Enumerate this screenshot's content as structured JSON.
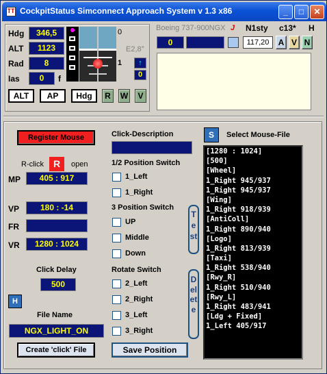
{
  "title": "CockpitStatus Simconnect Approach System v 1.3   x86",
  "app_icon": "TT",
  "window_buttons": {
    "minimize": "_",
    "maximize": "□",
    "close": "✕"
  },
  "instruments": {
    "hdg_label": "Hdg",
    "hdg_value": "346,5",
    "alt_label": "ALT",
    "alt_value": "1123",
    "rad_label": "Rad",
    "rad_value": "8",
    "ias_label": "Ias",
    "ias_value": "0",
    "ias_flag": "f",
    "gauge_top_num": "0",
    "gauge_e_text": "E2,8°",
    "gauge_side_num": "1",
    "gauge_small_value": "0",
    "btn_alt": "ALT",
    "btn_ap": "AP",
    "btn_hdg": "Hdg",
    "btn_r": "R",
    "btn_w": "W",
    "btn_v": "V"
  },
  "aircraft": {
    "name": "Boeing 737-900NGX",
    "j": "J",
    "n1sty": "N1sty",
    "c13": "c13*",
    "h": "H",
    "value_box": "0",
    "n1_value": "117,20",
    "btn_a": "A",
    "btn_v": "V",
    "btn_n": "N"
  },
  "left_panel": {
    "register_mouse": "Register Mouse",
    "rclick_label": "R-click",
    "rclick_letter": "R",
    "open_label": "open",
    "mp_label": "MP",
    "mp_value": "405 : 917",
    "vp_label": "VP",
    "vp_value": "180 : -14",
    "fr_label": "FR",
    "fr_value": "",
    "vr_label": "VR",
    "vr_value": "1280 : 1024",
    "click_delay_label": "Click Delay",
    "click_delay_value": "500",
    "h_button": "H",
    "file_name_label": "File Name",
    "file_name_value": "NGX_LIGHT_ON",
    "create_button": "Create 'click' File"
  },
  "mid_panel": {
    "click_desc_label": "Click-Description",
    "click_desc_value": "",
    "half_pos_label": "1/2  Position Switch",
    "half_items": [
      "1_Left",
      "1_Right"
    ],
    "three_pos_label": "3 Position Switch",
    "three_items": [
      "UP",
      "Middle",
      "Down"
    ],
    "rotate_label": "Rotate Switch",
    "rotate_items": [
      "2_Left",
      "2_Right",
      "3_Left",
      "3_Right"
    ],
    "test_button": "Test",
    "delete_button": "Delete",
    "save_button": "Save  Position"
  },
  "right_panel": {
    "s_button": "S",
    "select_label": "Select Mouse-File",
    "lines": [
      "[1280 : 1024]",
      "[500]",
      "[Wheel]",
      "1_Right 945/937",
      "1_Right 945/937",
      "[Wing]",
      "1_Right 918/939",
      "[AntiColl]",
      "1_Right 890/940",
      "[Logo]",
      "1_Right 813/939",
      "[Taxi]",
      "1_Right 538/940",
      "[Rwy_R]",
      "1_Right 510/940",
      "[Rwy_L]",
      "1_Right 483/941",
      "[Ldg  + Fixed]",
      "1_Left 405/917"
    ]
  }
}
